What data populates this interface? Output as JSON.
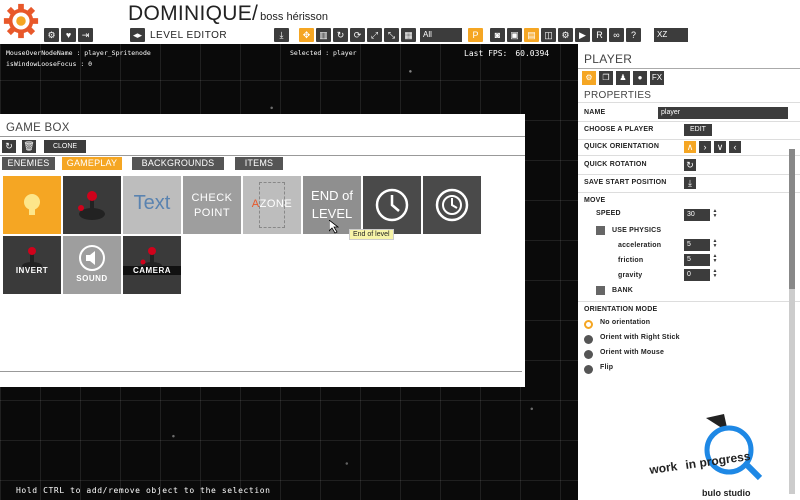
{
  "app": {
    "title": "DOMINIQUE/",
    "subtitle": "boss hérisson",
    "editor_label": "LEVEL EDITOR"
  },
  "toolbar": {
    "layer_value": "All",
    "coord_value": "XZ"
  },
  "debug": {
    "mouse_over": "MouseOverNodeName : player_Spritenode",
    "window_focus": "isWindowLooseFocus : 0",
    "selected": "Selected : player",
    "fps_label": "Last FPS:",
    "fps_value": "60.0394"
  },
  "gamebox": {
    "title": "GAME BOX",
    "clone_label": "CLONE",
    "tabs": [
      "ENEMIES",
      "GAMEPLAY",
      "BACKGROUNDS",
      "ITEMS"
    ],
    "tiles": {
      "text": "Text",
      "checkpoint_line1": "CHECK",
      "checkpoint_line2": "POINT",
      "aizone_a": "A",
      "aizone_rest": "ZONE",
      "endlevel_line1": "END of",
      "endlevel_line2": "LEVEL",
      "invert": "INVERT",
      "sound": "SOUND",
      "camera": "CAMERA"
    },
    "tooltip": "End of level"
  },
  "panel": {
    "title": "PLAYER",
    "properties_title": "PROPERTIES",
    "name_label": "NAME",
    "name_value": "player",
    "choose_label": "CHOOSE A PLAYER",
    "edit_label": "EDIT",
    "quick_orientation": "QUICK ORIENTATION",
    "quick_rotation": "QUICK ROTATION",
    "save_start": "SAVE START POSITION",
    "move": "MOVE",
    "speed_label": "SPEED",
    "speed_value": "30",
    "use_physics": "USE PHYSICS",
    "acceleration_label": "acceleration",
    "acceleration_value": "5",
    "friction_label": "friction",
    "friction_value": "5",
    "gravity_label": "gravity",
    "gravity_value": "0",
    "bank": "BANK",
    "orientation_mode": "ORIENTATION MODE",
    "orientation_options": [
      "No orientation",
      "Orient with Right Stick",
      "Orient with Mouse",
      "Flip"
    ]
  },
  "hint": "Hold CTRL to add/remove object to the selection",
  "brand": {
    "line1": "work",
    "line2": "in",
    "line3": "progress",
    "studio": "bulo studio"
  },
  "colors": {
    "accent": "#f5a623",
    "dark": "#3c3c3c"
  }
}
